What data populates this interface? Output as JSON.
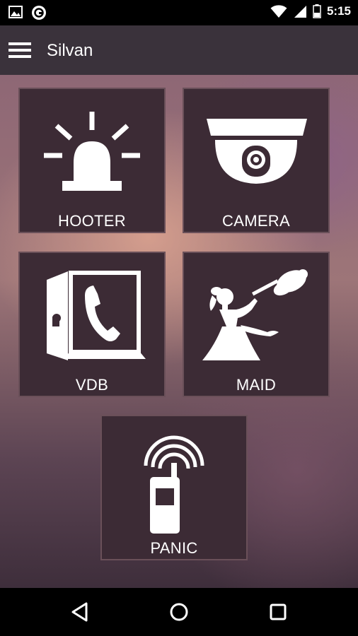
{
  "status_bar": {
    "time": "5:15",
    "left_icons": [
      "image-icon",
      "app-notification-icon"
    ],
    "right_icons": [
      "wifi-icon",
      "cell-signal-icon",
      "battery-icon"
    ]
  },
  "app_bar": {
    "title": "Silvan",
    "menu_icon": "hamburger-menu-icon"
  },
  "tiles": [
    {
      "label": "HOOTER",
      "icon": "siren-icon"
    },
    {
      "label": "CAMERA",
      "icon": "dome-camera-icon"
    },
    {
      "label": "VDB",
      "icon": "door-phone-icon"
    },
    {
      "label": "MAID",
      "icon": "maid-icon"
    },
    {
      "label": "PANIC",
      "icon": "panic-phone-icon"
    }
  ],
  "nav_bar": {
    "buttons": [
      "back-icon",
      "home-icon",
      "recents-icon"
    ]
  },
  "colors": {
    "app_bar": "#3a323b",
    "tile_background": "#3c2b35",
    "tile_border": "#6a5059",
    "text": "#ffffff"
  }
}
